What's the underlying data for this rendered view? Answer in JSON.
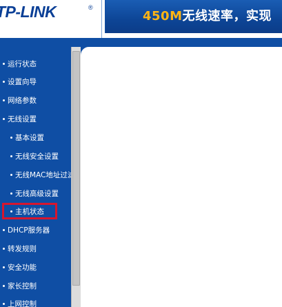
{
  "header": {
    "logo": "TP-LINK",
    "banner_highlight": "450M",
    "banner_text": "无线速率，实现"
  },
  "sidebar": {
    "items": [
      {
        "label": "运行状态",
        "level": 1
      },
      {
        "label": "设置向导",
        "level": 1
      },
      {
        "label": "网络参数",
        "level": 1
      },
      {
        "label": "无线设置",
        "level": 1
      },
      {
        "label": "基本设置",
        "level": 2
      },
      {
        "label": "无线安全设置",
        "level": 2
      },
      {
        "label": "无线MAC地址过滤",
        "level": 2
      },
      {
        "label": "无线高级设置",
        "level": 2
      },
      {
        "label": "主机状态",
        "level": 2,
        "highlighted": true
      },
      {
        "label": "DHCP服务器",
        "level": 1
      },
      {
        "label": "转发规则",
        "level": 1
      },
      {
        "label": "安全功能",
        "level": 1
      },
      {
        "label": "家长控制",
        "level": 1
      },
      {
        "label": "上网控制",
        "level": 1
      }
    ]
  },
  "colors": {
    "brand_blue": "#0f4ea4",
    "highlight_red": "#d7162e",
    "banner_orange": "#ffb514"
  }
}
